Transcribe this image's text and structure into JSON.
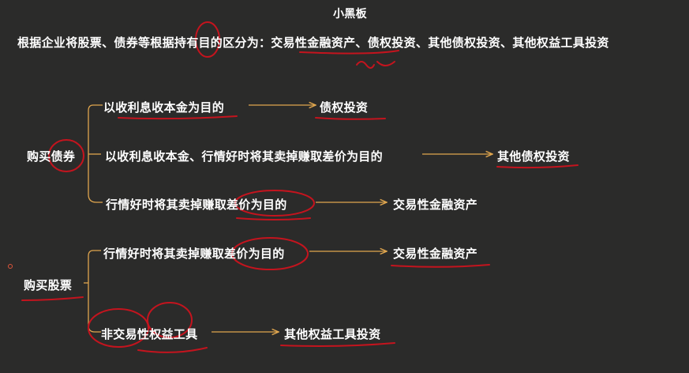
{
  "title": "小黑板",
  "intro": "根据企业将股票、债券等根据持有目的区分为：交易性金融资产、债权投资、其他债权投资、其他权益工具投资",
  "bonds": {
    "group_label": "购买债券",
    "rows": [
      {
        "purpose": "以收利息收本金为目的",
        "result": "债权投资"
      },
      {
        "purpose": "以收利息收本金、行情好时将其卖掉赚取差价为目的",
        "result": "其他债权投资"
      },
      {
        "purpose": "行情好时将其卖掉赚取差价为目的",
        "result": "交易性金融资产"
      }
    ]
  },
  "stocks": {
    "group_label": "购买股票",
    "rows": [
      {
        "purpose": "行情好时将其卖掉赚取差价为目的",
        "result": "交易性金融资产"
      },
      {
        "purpose": "非交易性权益工具",
        "result": "其他权益工具投资"
      }
    ]
  },
  "colors": {
    "background": "#2b2b2a",
    "text": "#ffffff",
    "connector": "#e0a64e",
    "annotation": "#c4141e"
  }
}
